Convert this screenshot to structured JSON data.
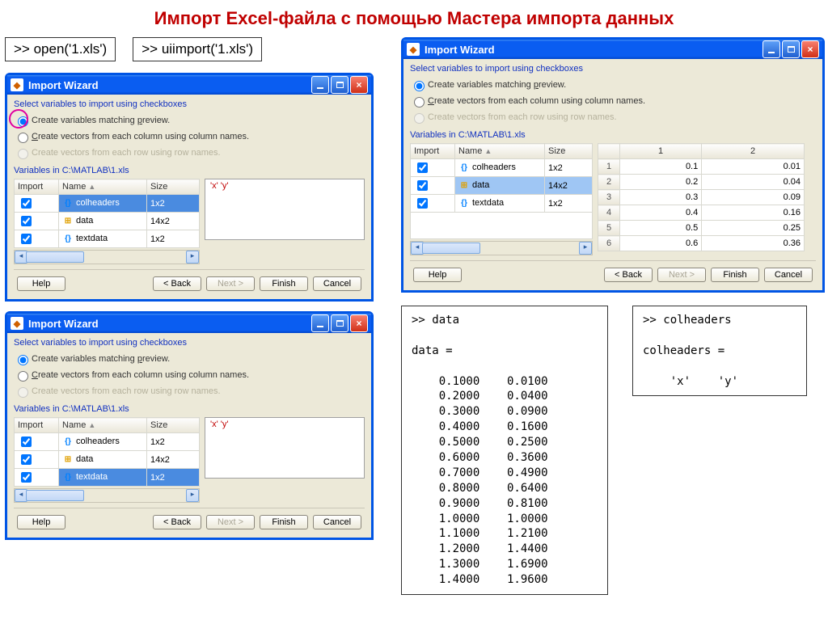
{
  "page_title": "Импорт Excel-файла с помощью Мастера импорта данных",
  "cmd": {
    "open": ">> open('1.xls')",
    "uiimport": ">> uiimport('1.xls')"
  },
  "win": {
    "title": "Import Wizard",
    "instr": "Select variables to import using checkboxes",
    "rad1_pre": "Create variables matching ",
    "rad1_u": "p",
    "rad1_post": "review.",
    "rad2_pre": "",
    "rad2_u": "C",
    "rad2_post": "reate vectors from each column using column names.",
    "rad3": "Create vectors from each row using row names.",
    "varpath_pre": "Variables in ",
    "varpath_link": "C:\\MATLAB\\1.xls",
    "cols": {
      "import": "Import",
      "name": "Name",
      "size": "Size"
    },
    "vars": [
      {
        "name": "colheaders",
        "size": "1x2",
        "type": "cell"
      },
      {
        "name": "data",
        "size": "14x2",
        "type": "num"
      },
      {
        "name": "textdata",
        "size": "1x2",
        "type": "cell"
      }
    ],
    "preview_xy": "'x'   'y'",
    "datacols": [
      "1",
      "2"
    ],
    "datarows": [
      [
        "1",
        "0.1",
        "0.01"
      ],
      [
        "2",
        "0.2",
        "0.04"
      ],
      [
        "3",
        "0.3",
        "0.09"
      ],
      [
        "4",
        "0.4",
        "0.16"
      ],
      [
        "5",
        "0.5",
        "0.25"
      ],
      [
        "6",
        "0.6",
        "0.36"
      ]
    ]
  },
  "btns": {
    "help": "Help",
    "back": "< Back",
    "next": "Next >",
    "finish": "Finish",
    "cancel": "Cancel"
  },
  "out_data": {
    "cmd": ">> data",
    "echo": "data =",
    "rows": [
      "    0.1000    0.0100",
      "    0.2000    0.0400",
      "    0.3000    0.0900",
      "    0.4000    0.1600",
      "    0.5000    0.2500",
      "    0.6000    0.3600",
      "    0.7000    0.4900",
      "    0.8000    0.6400",
      "    0.9000    0.8100",
      "    1.0000    1.0000",
      "    1.1000    1.2100",
      "    1.2000    1.4400",
      "    1.3000    1.6900",
      "    1.4000    1.9600"
    ]
  },
  "out_col": {
    "cmd": ">> colheaders",
    "echo": "colheaders =",
    "val": "    'x'    'y'"
  }
}
